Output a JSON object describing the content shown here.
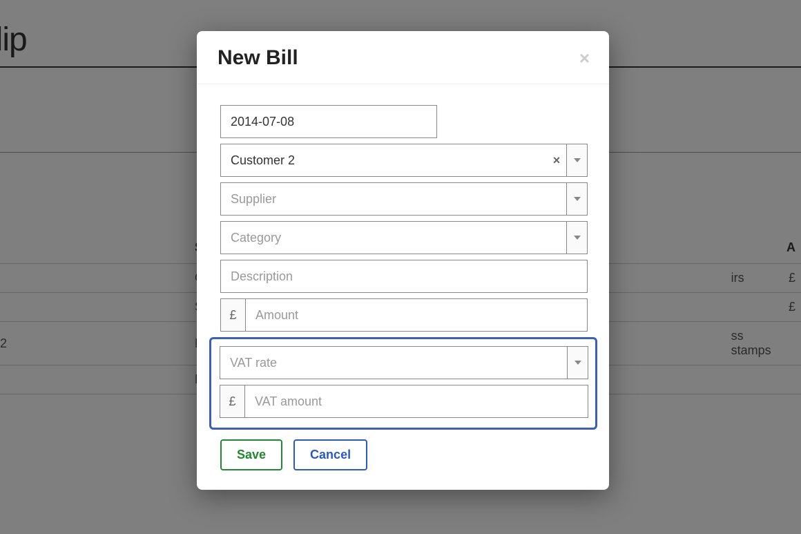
{
  "background": {
    "app_title": "Clip",
    "table": {
      "headers": {
        "supplier": "Supplier",
        "amount": "A"
      },
      "rows": [
        {
          "col1": "",
          "supplier": "Office Supp",
          "detail": "irs",
          "amount": "£"
        },
        {
          "col1": "",
          "supplier": "Supermark",
          "detail": "",
          "amount": "£"
        },
        {
          "col1": "2",
          "supplier": "Post Office",
          "detail": "ss stamps",
          "amount": ""
        },
        {
          "col1": "",
          "supplier": "Reprograp",
          "detail": "",
          "amount": ""
        }
      ]
    }
  },
  "modal": {
    "title": "New Bill",
    "fields": {
      "date": {
        "value": "2014-07-08"
      },
      "customer": {
        "value": "Customer 2"
      },
      "supplier": {
        "placeholder": "Supplier"
      },
      "category": {
        "placeholder": "Category"
      },
      "description": {
        "placeholder": "Description"
      },
      "currency_symbol": "£",
      "amount": {
        "placeholder": "Amount"
      },
      "vat_rate": {
        "placeholder": "VAT rate"
      },
      "vat_amount": {
        "placeholder": "VAT amount"
      }
    },
    "buttons": {
      "save": "Save",
      "cancel": "Cancel"
    }
  }
}
